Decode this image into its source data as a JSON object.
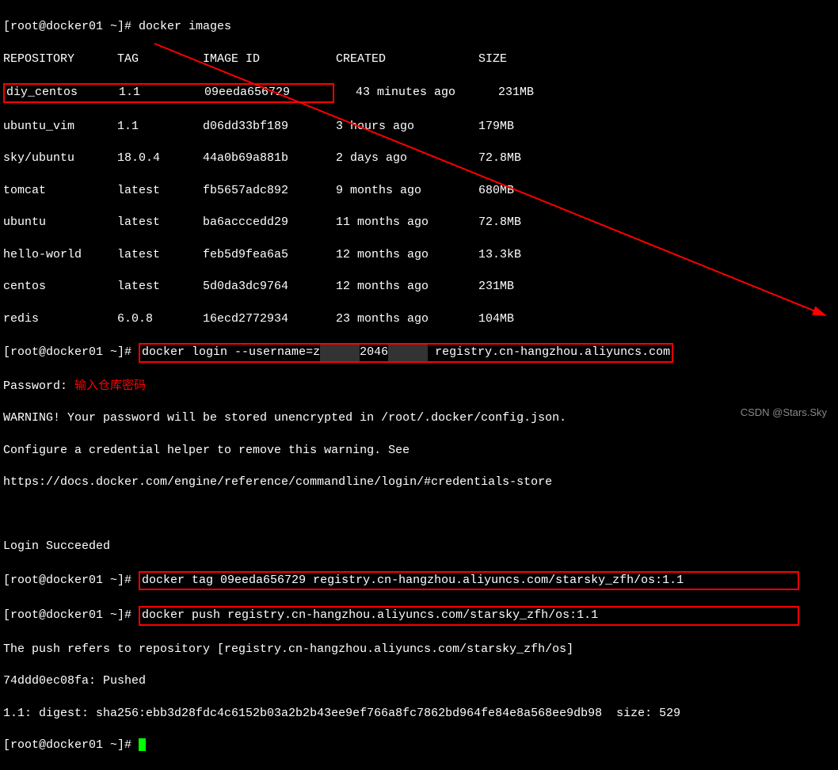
{
  "prompt": "[root@docker01 ~]# ",
  "cmd_images": "docker images",
  "headers": {
    "repo": "REPOSITORY",
    "tag": "TAG",
    "id": "IMAGE ID",
    "created": "CREATED",
    "size": "SIZE"
  },
  "images": [
    {
      "repo": "diy_centos",
      "tag": "1.1",
      "id": "09eeda656729",
      "created": "43 minutes ago",
      "size": "231MB"
    },
    {
      "repo": "ubuntu_vim",
      "tag": "1.1",
      "id": "d06dd33bf189",
      "created": "3 hours ago",
      "size": "179MB"
    },
    {
      "repo": "sky/ubuntu",
      "tag": "18.0.4",
      "id": "44a0b69a881b",
      "created": "2 days ago",
      "size": "72.8MB"
    },
    {
      "repo": "tomcat",
      "tag": "latest",
      "id": "fb5657adc892",
      "created": "9 months ago",
      "size": "680MB"
    },
    {
      "repo": "ubuntu",
      "tag": "latest",
      "id": "ba6acccedd29",
      "created": "11 months ago",
      "size": "72.8MB"
    },
    {
      "repo": "hello-world",
      "tag": "latest",
      "id": "feb5d9fea6a5",
      "created": "12 months ago",
      "size": "13.3kB"
    },
    {
      "repo": "centos",
      "tag": "latest",
      "id": "5d0da3dc9764",
      "created": "12 months ago",
      "size": "231MB"
    },
    {
      "repo": "redis",
      "tag": "6.0.8",
      "id": "16ecd2772934",
      "created": "23 months ago",
      "size": "104MB"
    }
  ],
  "cmd_login_pre": "docker login --username=z",
  "cmd_login_mid": "2046",
  "cmd_login_post": "registry.cn-hangzhou.aliyuncs.com",
  "password_label": "Password: ",
  "password_hint": "输入仓库密码",
  "warning1": "WARNING! Your password will be stored unencrypted in /root/.docker/config.json.",
  "warning2": "Configure a credential helper to remove this warning. See",
  "warning3": "https://docs.docker.com/engine/reference/commandline/login/#credentials-store",
  "login_success": "Login Succeeded",
  "cmd_tag": "docker tag 09eeda656729 registry.cn-hangzhou.aliyuncs.com/starsky_zfh/os:1.1",
  "cmd_push": "docker push registry.cn-hangzhou.aliyuncs.com/starsky_zfh/os:1.1",
  "push_refers": "The push refers to repository [registry.cn-hangzhou.aliyuncs.com/starsky_zfh/os]",
  "push_layer": "74ddd0ec08fa: Pushed",
  "push_digest": "1.1: digest: sha256:ebb3d28fdc4c6152b03a2b2b43ee9ef766a8fc7862bd964fe84e8a568ee9db98  size: 529",
  "watermark": "CSDN @Stars.Sky"
}
